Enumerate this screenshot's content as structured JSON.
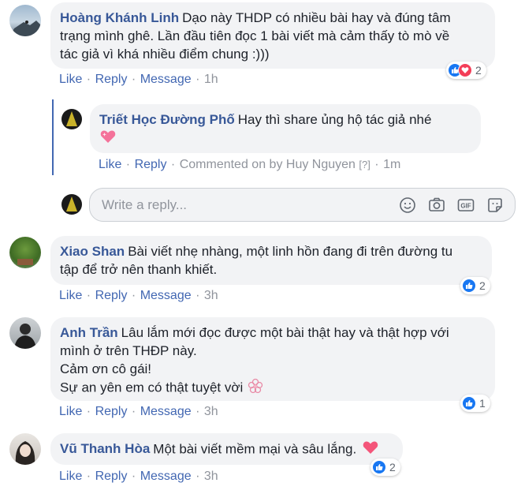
{
  "comments": [
    {
      "author": "Hoàng Khánh Linh",
      "lines": [
        "Dạo này THDP có nhiều bài hay và đúng tâm",
        "trạng mình ghê. Lần đầu tiên đọc 1 bài viết mà cảm thấy tò mò về",
        "tác giả vì khá nhiều điểm chung :)))"
      ],
      "like": "Like",
      "reply": "Reply",
      "message": "Message",
      "time": "1h",
      "reaction_count": "2"
    },
    {
      "author": "Xiao Shan",
      "lines": [
        "Bài viết nhẹ nhàng, một linh hồn đang đi trên đường tu",
        "tập để trở nên thanh khiết."
      ],
      "like": "Like",
      "reply": "Reply",
      "message": "Message",
      "time": "3h",
      "reaction_count": "2"
    },
    {
      "author": "Anh Trần",
      "lines": [
        "Lâu lắm mới đọc được một bài thật hay và thật hợp với",
        "mình ở trên THĐP này.",
        "Cảm ơn cô gái!",
        "Sự an yên em có thật tuyệt vời"
      ],
      "like": "Like",
      "reply": "Reply",
      "message": "Message",
      "time": "3h",
      "reaction_count": "1"
    },
    {
      "author": "Vũ Thanh Hòa",
      "lines": [
        "Một bài viết mềm mại và sâu lắng."
      ],
      "like": "Like",
      "reply": "Reply",
      "message": "Message",
      "time": "3h",
      "reaction_count": "2"
    }
  ],
  "reply": {
    "author": "Triết Học Đường Phố",
    "text": "Hay thì share ủng hộ tác giả nhé",
    "like": "Like",
    "reply": "Reply",
    "commented_on": "Commented on by Huy Nguyen",
    "help": "[?]",
    "time": "1m"
  },
  "composer": {
    "placeholder": "Write a reply...",
    "icons": [
      "emoji-icon",
      "camera-icon",
      "gif-icon",
      "sticker-icon"
    ]
  },
  "colors": {
    "link": "#385898",
    "action": "#4267b2",
    "like": "#1877f2",
    "heart": "#f33e58",
    "bubble": "#f2f3f5"
  }
}
